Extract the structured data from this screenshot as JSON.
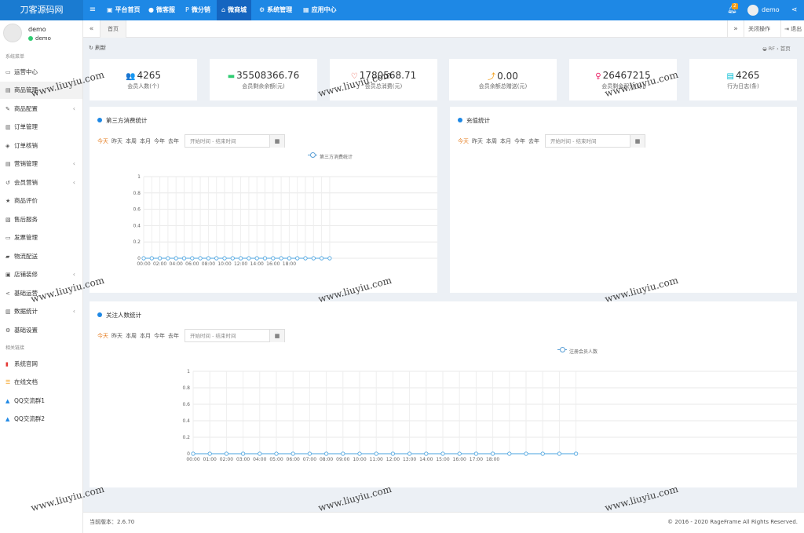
{
  "topbar": {
    "brand": "刀客源码网",
    "menu_icon": "menu-icon",
    "nav": [
      {
        "icon": "▣",
        "label": "平台首页"
      },
      {
        "icon": "●",
        "label": "微客服"
      },
      {
        "icon": "P",
        "label": "微分销"
      },
      {
        "icon": "⌂",
        "label": "微商城"
      },
      {
        "icon": "⚙",
        "label": "系统管理"
      },
      {
        "icon": "▦",
        "label": "应用中心"
      }
    ],
    "active_nav": "微商城",
    "notification_count": "2",
    "user": "demo"
  },
  "sidebar": {
    "username": "demo",
    "status": "demo",
    "section_system": "系统菜单",
    "items": [
      {
        "icon": "▭",
        "label": "运营中心",
        "arrow": ""
      },
      {
        "icon": "▤",
        "label": "商品管理",
        "arrow": ""
      },
      {
        "icon": "✎",
        "label": "商品配置",
        "arrow": "‹"
      },
      {
        "icon": "▥",
        "label": "订单管理",
        "arrow": ""
      },
      {
        "icon": "◈",
        "label": "订单核销",
        "arrow": ""
      },
      {
        "icon": "▤",
        "label": "营销管理",
        "arrow": "‹"
      },
      {
        "icon": "↺",
        "label": "会员营销",
        "arrow": "‹"
      },
      {
        "icon": "★",
        "label": "商品评价",
        "arrow": ""
      },
      {
        "icon": "▧",
        "label": "售后服务",
        "arrow": ""
      },
      {
        "icon": "▭",
        "label": "发票管理",
        "arrow": ""
      },
      {
        "icon": "▰",
        "label": "物流配送",
        "arrow": ""
      },
      {
        "icon": "▣",
        "label": "店铺装修",
        "arrow": "‹"
      },
      {
        "icon": "<",
        "label": "基础运营",
        "arrow": ""
      },
      {
        "icon": "▥",
        "label": "数据统计",
        "arrow": "‹"
      },
      {
        "icon": "⚙",
        "label": "基础设置",
        "arrow": ""
      }
    ],
    "section_links": "相关链接",
    "links": [
      {
        "icon": "▮",
        "label": "系统官网",
        "color": "#e53935"
      },
      {
        "icon": "☰",
        "label": "在线文档",
        "color": "#f39c12"
      },
      {
        "icon": "▲",
        "label": "QQ交流群1",
        "color": "#1e88e5"
      },
      {
        "icon": "▲",
        "label": "QQ交流群2",
        "color": "#1e88e5"
      }
    ]
  },
  "tabs": {
    "prev": "«",
    "home": "首页",
    "next": "»",
    "close_ops": "关闭操作",
    "logout": "退出"
  },
  "toolbar": {
    "refresh": "刷新",
    "breadcrumb_root": "RF",
    "breadcrumb_sep": "›",
    "breadcrumb_page": "首页"
  },
  "stats": [
    {
      "icon": "👥",
      "value": "4265",
      "label": "会员人数(个)",
      "color": "#1e88e5"
    },
    {
      "icon": "▬",
      "value": "35508366.76",
      "label": "会员剩余余额(元)",
      "color": "#2ecc71"
    },
    {
      "icon": "♡",
      "value": "1780568.71",
      "label": "会员总消费(元)",
      "color": "#e74c3c"
    },
    {
      "icon": "⤴",
      "value": "0.00",
      "label": "会员余额总赠送(元)",
      "color": "#f39c12"
    },
    {
      "icon": "♀",
      "value": "26467215",
      "label": "会员剩余积分(分)",
      "color": "#e91e63"
    },
    {
      "icon": "▤",
      "value": "4265",
      "label": "行为日志(条)",
      "color": "#00bcd4"
    }
  ],
  "filters": {
    "today": "今天",
    "yesterday": "昨天",
    "this_week": "本周",
    "this_month": "本月",
    "this_year": "今年",
    "last_year": "去年",
    "date_placeholder": "开始时间 - 结束时间"
  },
  "panels": {
    "consume_title": "第三方消费统计",
    "recharge_title": "充值统计",
    "follow_title": "关注人数统计"
  },
  "chart_data": [
    {
      "type": "line",
      "x": [
        "00:00",
        "01:00",
        "02:00",
        "03:00",
        "04:00",
        "05:00",
        "06:00",
        "07:00",
        "08:00",
        "09:00",
        "10:00",
        "11:00",
        "12:00",
        "13:00",
        "14:00",
        "15:00",
        "16:00",
        "17:00",
        "18:00",
        "19:00",
        "20:00",
        "21:00",
        "22:00",
        "23:00"
      ],
      "x_tick_labels": [
        "00:00",
        "02:00",
        "04:00",
        "06:00",
        "08:00",
        "10:00",
        "12:00",
        "14:00",
        "16:00",
        "18:00"
      ],
      "series": [
        {
          "name": "第三方消费统计",
          "values": [
            0,
            0,
            0,
            0,
            0,
            0,
            0,
            0,
            0,
            0,
            0,
            0,
            0,
            0,
            0,
            0,
            0,
            0,
            0,
            0,
            0,
            0,
            0,
            0
          ]
        }
      ],
      "ylim": [
        0,
        1
      ],
      "y_ticks": [
        "0",
        "0.2",
        "0.4",
        "0.6",
        "0.8",
        "1"
      ],
      "grid": true,
      "color": "#4aa3df"
    },
    {
      "type": "line",
      "x": [
        "00:00",
        "01:00",
        "02:00",
        "03:00",
        "04:00",
        "05:00",
        "06:00",
        "07:00",
        "08:00",
        "09:00",
        "10:00",
        "11:00",
        "12:00",
        "13:00",
        "14:00",
        "15:00",
        "16:00",
        "17:00",
        "18:00",
        "19:00",
        "20:00",
        "21:00",
        "22:00",
        "23:00"
      ],
      "x_tick_labels": [
        "00:00",
        "01:00",
        "02:00",
        "03:00",
        "04:00",
        "05:00",
        "06:00",
        "07:00",
        "08:00",
        "09:00",
        "10:00",
        "11:00",
        "12:00",
        "13:00",
        "14:00",
        "15:00",
        "16:00",
        "17:00",
        "18:00"
      ],
      "series": [
        {
          "name": "注册会员人数",
          "values": [
            0,
            0,
            0,
            0,
            0,
            0,
            0,
            0,
            0,
            0,
            0,
            0,
            0,
            0,
            0,
            0,
            0,
            0,
            0,
            0,
            0,
            0,
            0,
            0
          ]
        }
      ],
      "ylim": [
        0,
        1
      ],
      "y_ticks": [
        "0",
        "0.2",
        "0.4",
        "0.6",
        "0.8",
        "1"
      ],
      "grid": true,
      "color": "#4aa3df"
    }
  ],
  "footer": {
    "version": "当前版本：2.6.70",
    "copyright": "© 2016 - 2020 RageFrame All Rights Reserved."
  },
  "watermark": "www.liuyiu.com"
}
